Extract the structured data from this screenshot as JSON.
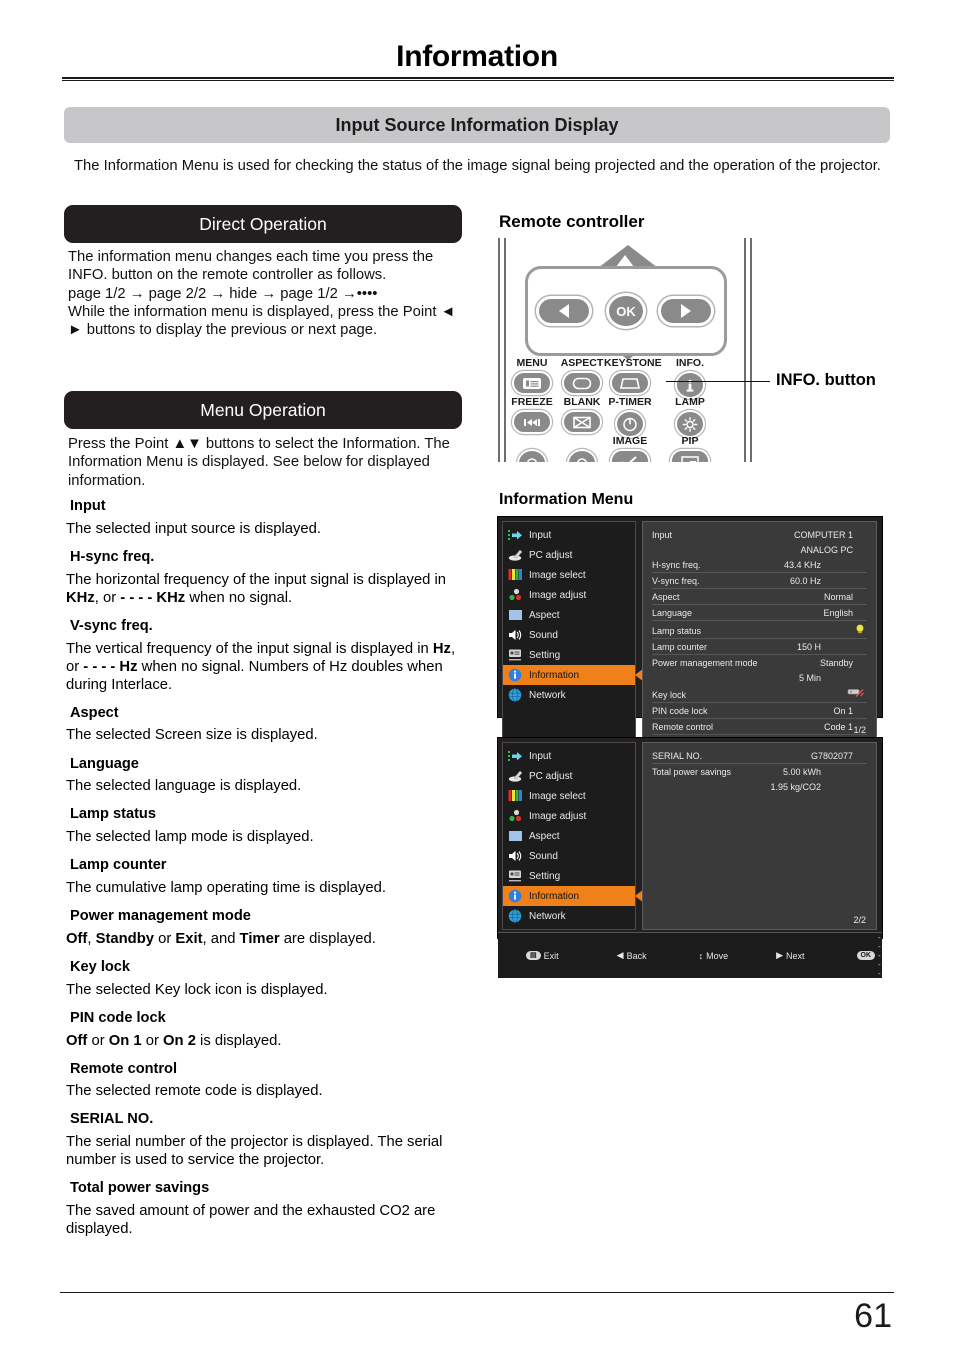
{
  "page": {
    "title": "Information",
    "number": "61"
  },
  "section": {
    "heading": "Input Source Information Display",
    "intro": "The Information Menu is used for checking the status of the image signal being projected and the operation of the projector."
  },
  "direct_operation": {
    "banner": "Direct Operation",
    "text": "The information menu changes each time you press the INFO. button on the remote controller as follows.\npage 1/2 → page 2/2 → hide → page 1/2 →••••\nWhile the information menu is displayed, press the Point ◄ ► buttons to display the previous or next page."
  },
  "menu_operation": {
    "banner": "Menu Operation",
    "text": "Press the Point ▲▼ buttons to select the Information. The Information Menu is displayed. See below for displayed information."
  },
  "definitions": [
    {
      "term": "Input",
      "desc": "The selected input source is displayed."
    },
    {
      "term": "H-sync freq.",
      "desc": "The horizontal frequency of the input signal is displayed in <b>KHz</b>, or <b>- - - - KHz</b> when no signal."
    },
    {
      "term": "V-sync freq.",
      "desc": "The vertical frequency of the input signal is displayed in <b>Hz</b>, or <b>- - - - Hz</b> when no signal. Numbers of Hz doubles when during Interlace."
    },
    {
      "term": "Aspect",
      "desc": "The selected Screen size is displayed."
    },
    {
      "term": "Language",
      "desc": "The selected language is displayed."
    },
    {
      "term": "Lamp status",
      "desc": "The selected lamp mode is displayed."
    },
    {
      "term": "Lamp counter",
      "desc": "The cumulative lamp operating time is displayed."
    },
    {
      "term": "Power management mode",
      "desc": "<b>Off</b>, <b>Standby</b> or <b>Exit</b>, and <b>Timer</b> are displayed."
    },
    {
      "term": "Key lock",
      "desc": "The selected Key lock icon is displayed."
    },
    {
      "term": "PIN code lock",
      "desc": "<b>Off</b> or <b>On 1</b> or <b>On 2</b> is displayed."
    },
    {
      "term": "Remote control",
      "desc": "The selected remote code  is displayed."
    },
    {
      "term": "SERIAL NO.",
      "desc": "The serial number of the projector is displayed. The serial number is used to service the projector."
    },
    {
      "term": "Total power savings",
      "desc": "The saved amount of power and the exhausted CO2 are displayed."
    }
  ],
  "remote": {
    "title": "Remote controller",
    "ok_label": "OK",
    "callout": "INFO. button",
    "keys_row1": [
      {
        "label": "MENU",
        "icon": "menu-icon"
      },
      {
        "label": "ASPECT",
        "icon": "aspect-icon"
      },
      {
        "label": "KEYSTONE",
        "icon": "keystone-icon"
      },
      {
        "label": "INFO.",
        "icon": "info-icon"
      }
    ],
    "keys_row2": [
      {
        "label": "FREEZE",
        "icon": "freeze-icon"
      },
      {
        "label": "BLANK",
        "icon": "blank-icon"
      },
      {
        "label": "P-TIMER",
        "icon": "ptimer-icon"
      },
      {
        "label": "LAMP",
        "icon": "lamp-icon"
      }
    ],
    "keys_row3": [
      {
        "label": "",
        "icon": "unknown-icon"
      },
      {
        "label": "",
        "icon": "unknown-icon"
      },
      {
        "label": "IMAGE",
        "icon": "image-icon"
      },
      {
        "label": "PIP",
        "icon": "pip-icon"
      }
    ]
  },
  "osd": {
    "caption": "Information Menu",
    "accent_color": "#f0811a",
    "sidebar": [
      {
        "label": "Input",
        "icon": "input-icon"
      },
      {
        "label": "PC adjust",
        "icon": "pc-adjust-icon"
      },
      {
        "label": "Image select",
        "icon": "image-select-icon"
      },
      {
        "label": "Image adjust",
        "icon": "image-adjust-icon"
      },
      {
        "label": "Aspect",
        "icon": "aspect-icon"
      },
      {
        "label": "Sound",
        "icon": "sound-icon"
      },
      {
        "label": "Setting",
        "icon": "setting-icon"
      },
      {
        "label": "Information",
        "icon": "information-icon"
      },
      {
        "label": "Network",
        "icon": "network-icon"
      }
    ],
    "active_index": 7,
    "page1": {
      "rows": [
        {
          "label": "Input",
          "value": "COMPUTER 1"
        },
        {
          "label": "",
          "value": "ANALOG PC"
        },
        {
          "label": "H-sync freq.",
          "value": "43.4  KHz",
          "align": "narrow"
        },
        {
          "label": "V-sync freq.",
          "value": "60.0  Hz",
          "align": "narrow"
        },
        {
          "label": "Aspect",
          "value": "Normal"
        },
        {
          "label": "Language",
          "value": "English"
        },
        {
          "label": "Lamp status",
          "value": "●",
          "icon": "lamp-status-icon"
        },
        {
          "label": "Lamp counter",
          "value": "150  H",
          "align": "narrow"
        },
        {
          "label": "Power management mode",
          "value": "Standby"
        },
        {
          "label": "",
          "value": "5  Min",
          "align": "narrow"
        },
        {
          "label": "Key lock",
          "value": "",
          "icon": "key-lock-icon"
        },
        {
          "label": "PIN code lock",
          "value": "On 1"
        },
        {
          "label": "Remote control",
          "value": "Code 1"
        }
      ],
      "page_indicator": "1/2"
    },
    "page2": {
      "rows": [
        {
          "label": "SERIAL NO.",
          "value": "G7802077"
        },
        {
          "label": "Total power savings",
          "value": "5.00  kWh",
          "align": "narrow"
        },
        {
          "label": "",
          "value": "1.95  kg/CO2",
          "align": "narrow"
        }
      ],
      "page_indicator": "2/2"
    },
    "bottom_bar": [
      {
        "key": "MENU",
        "label": "Exit",
        "icon": "menu-pill-icon"
      },
      {
        "key": "◀",
        "label": "Back",
        "icon": "left-arrow-icon"
      },
      {
        "key": "↕",
        "label": "Move",
        "icon": "updown-arrow-icon"
      },
      {
        "key": "▶",
        "label": "Next",
        "icon": "right-arrow-icon"
      },
      {
        "key": "OK",
        "label": "- - - - -",
        "icon": "ok-pill-icon"
      }
    ]
  }
}
